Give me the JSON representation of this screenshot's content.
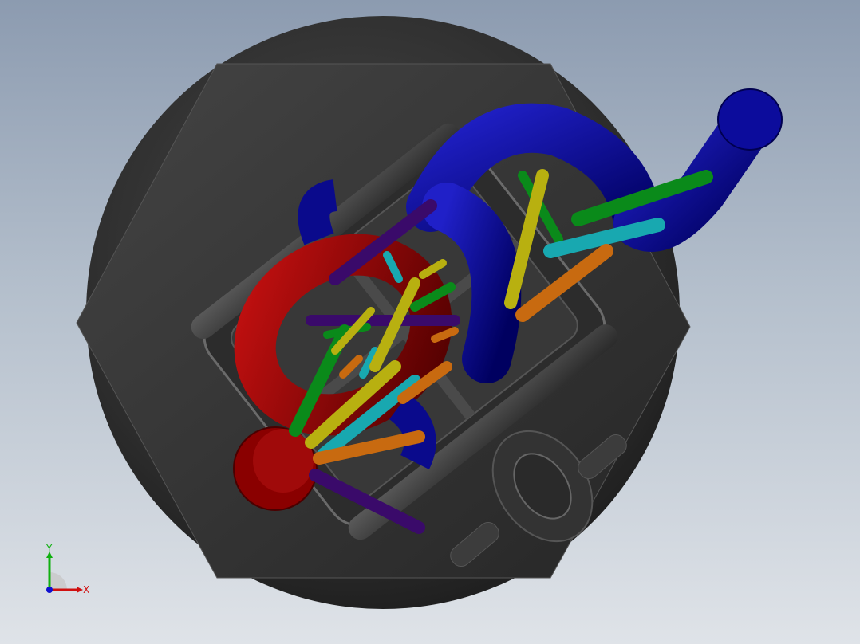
{
  "viewport": {
    "background_top": "#8c9bb0",
    "background_bottom": "#dfe3e8"
  },
  "model": {
    "body_color": "#3a3a3a",
    "tube_colors": {
      "blue": "#0a0a8c",
      "red": "#8a0000",
      "green": "#0a8a1a",
      "cyan": "#18a8b0",
      "yellow": "#b8b010",
      "orange": "#c86a10",
      "purple": "#3a0a6a"
    }
  },
  "triad": {
    "x_label": "X",
    "y_label": "Y",
    "x_color": "#d01010",
    "y_color": "#10b010",
    "z_color": "#1010d0"
  }
}
